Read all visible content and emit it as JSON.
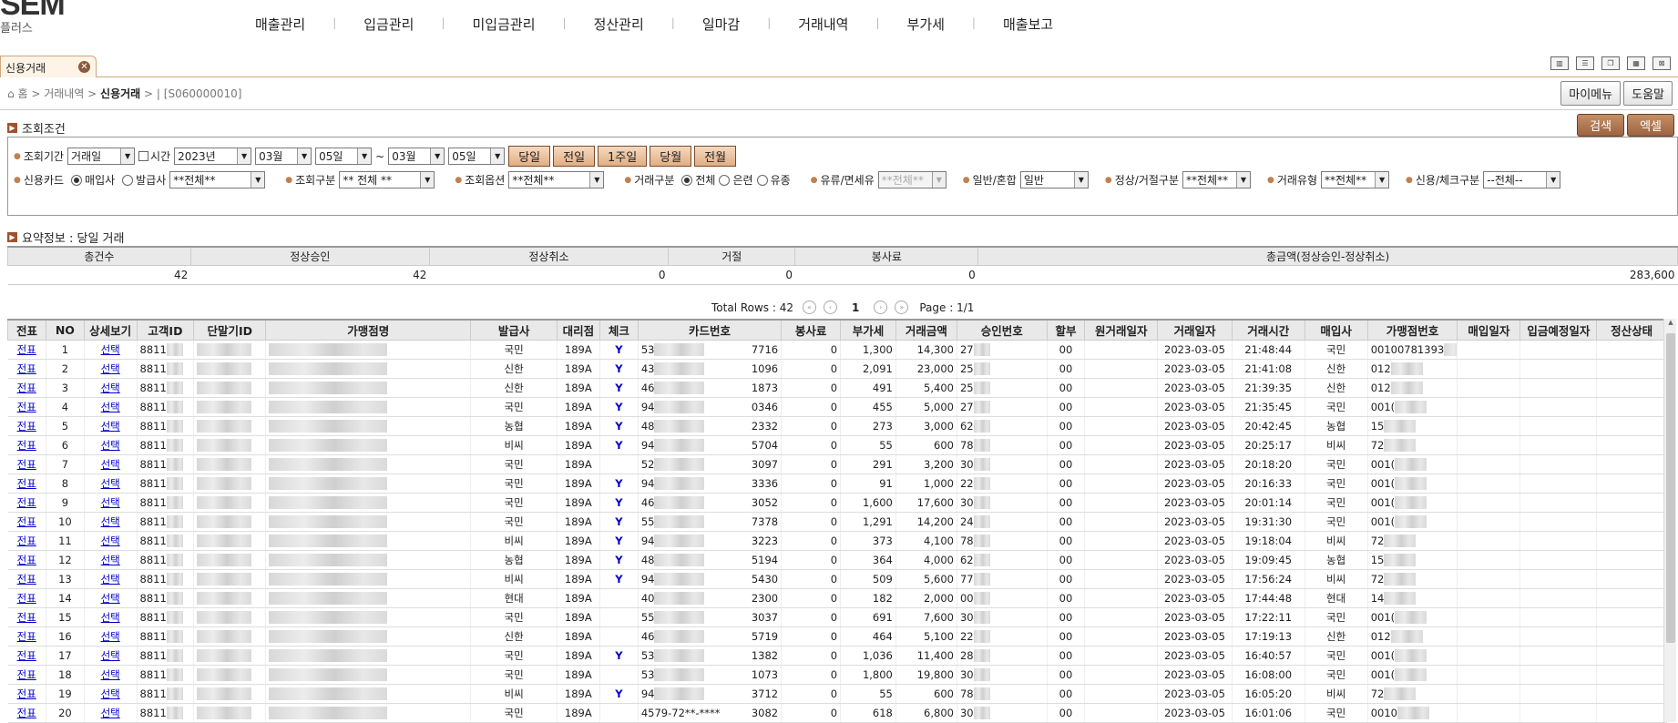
{
  "logo": {
    "big": "SEM",
    "sub": "플러스"
  },
  "nav": [
    "매출관리",
    "입금관리",
    "미입금관리",
    "정산관리",
    "일마감",
    "거래내역",
    "부가세",
    "매출보고"
  ],
  "tab": {
    "label": "신용거래"
  },
  "view_icons": [
    "layout-2col-icon",
    "layout-rows-icon",
    "layout-cascade-icon",
    "layout-grid-icon",
    "layout-close-icon"
  ],
  "breadcrumb": {
    "home": "홈",
    "level1": "거래내역",
    "current": "신용거래",
    "code": "| [S060000010]"
  },
  "top_buttons": {
    "mymenu": "마이메뉴",
    "help": "도움말"
  },
  "search": {
    "title": "조회조건",
    "search_btn": "검색",
    "excel_btn": "엑셀",
    "period_label": "조회기간",
    "period_type": "거래일",
    "time_label": "시간",
    "year": "2023년",
    "from_month": "03월",
    "from_day": "05일",
    "tilde": "~",
    "to_month": "03월",
    "to_day": "05일",
    "quick": [
      "당일",
      "전일",
      "1주일",
      "당월",
      "전월"
    ],
    "card_label": "신용카드",
    "card_opt1": "매입사",
    "card_opt2": "발급사",
    "card_value": "**전체**",
    "query_type_label": "조회구분",
    "query_type_value": "** 전체 **",
    "query_opt_label": "조회옵션",
    "query_opt_value": "**전체**",
    "tx_type_label": "거래구분",
    "tx_opt1": "전체",
    "tx_opt2": "은련",
    "tx_opt3": "유종",
    "tax_label": "유류/면세유",
    "tax_value": "**전체**",
    "general_label": "일반/혼합",
    "general_value": "일반",
    "normal_label": "정상/거절구분",
    "normal_value": "**전체**",
    "txkind_label": "거래유형",
    "txkind_value": "**전체**",
    "credit_label": "신용/체크구분",
    "credit_value": "--전체--"
  },
  "summary": {
    "title": "요약정보 : 당일 거래",
    "headers": [
      "총건수",
      "정상승인",
      "정상취소",
      "거절",
      "봉사료",
      "총금액(정상승인-정상취소)"
    ],
    "values": [
      "42",
      "42",
      "0",
      "0",
      "0",
      "283,600"
    ]
  },
  "pager": {
    "total_rows": "Total Rows : 42",
    "current": "1",
    "page_info": "Page : 1/1"
  },
  "grid": {
    "headers": [
      "전표",
      "NO",
      "상세보기",
      "고객ID",
      "단말기ID",
      "가맹점명",
      "발급사",
      "대리점",
      "체크",
      "카드번호",
      "봉사료",
      "부가세",
      "거래금액",
      "승인번호",
      "할부",
      "원거래일자",
      "거래일자",
      "거래시간",
      "매입사",
      "가맹점번호",
      "매입일자",
      "입금예정일자",
      "정산상태"
    ],
    "rows": [
      {
        "slip": "전표",
        "no": "1",
        "detail": "선택",
        "cust": "8811",
        "issuer": "국민",
        "agent": "189A",
        "check": "Y",
        "card_a": "53",
        "card_b": "7716",
        "svc": "0",
        "vat": "1,300",
        "amt": "14,300",
        "appr": "27",
        "inst": "00",
        "date": "2023-03-05",
        "time": "21:48:44",
        "acq": "국민",
        "merch": "00100781393"
      },
      {
        "slip": "전표",
        "no": "2",
        "detail": "선택",
        "cust": "8811",
        "issuer": "신한",
        "agent": "189A",
        "check": "Y",
        "card_a": "43",
        "card_b": "1096",
        "svc": "0",
        "vat": "2,091",
        "amt": "23,000",
        "appr": "25",
        "inst": "00",
        "date": "2023-03-05",
        "time": "21:41:08",
        "acq": "신한",
        "merch": "012"
      },
      {
        "slip": "전표",
        "no": "3",
        "detail": "선택",
        "cust": "8811",
        "issuer": "신한",
        "agent": "189A",
        "check": "Y",
        "card_a": "46",
        "card_b": "1873",
        "svc": "0",
        "vat": "491",
        "amt": "5,400",
        "appr": "25",
        "inst": "00",
        "date": "2023-03-05",
        "time": "21:39:35",
        "acq": "신한",
        "merch": "012"
      },
      {
        "slip": "전표",
        "no": "4",
        "detail": "선택",
        "cust": "8811",
        "issuer": "국민",
        "agent": "189A",
        "check": "Y",
        "card_a": "94",
        "card_b": "0346",
        "svc": "0",
        "vat": "455",
        "amt": "5,000",
        "appr": "27",
        "inst": "00",
        "date": "2023-03-05",
        "time": "21:35:45",
        "acq": "국민",
        "merch": "001("
      },
      {
        "slip": "전표",
        "no": "5",
        "detail": "선택",
        "cust": "8811",
        "issuer": "농협",
        "agent": "189A",
        "check": "Y",
        "card_a": "48",
        "card_b": "2332",
        "svc": "0",
        "vat": "273",
        "amt": "3,000",
        "appr": "62",
        "inst": "00",
        "date": "2023-03-05",
        "time": "20:42:45",
        "acq": "농협",
        "merch": "15"
      },
      {
        "slip": "전표",
        "no": "6",
        "detail": "선택",
        "cust": "8811",
        "issuer": "비씨",
        "agent": "189A",
        "check": "Y",
        "card_a": "94",
        "card_b": "5704",
        "svc": "0",
        "vat": "55",
        "amt": "600",
        "appr": "78",
        "inst": "00",
        "date": "2023-03-05",
        "time": "20:25:17",
        "acq": "비씨",
        "merch": "72"
      },
      {
        "slip": "전표",
        "no": "7",
        "detail": "선택",
        "cust": "8811",
        "issuer": "국민",
        "agent": "189A",
        "check": "",
        "card_a": "52",
        "card_b": "3097",
        "svc": "0",
        "vat": "291",
        "amt": "3,200",
        "appr": "30",
        "inst": "00",
        "date": "2023-03-05",
        "time": "20:18:20",
        "acq": "국민",
        "merch": "001("
      },
      {
        "slip": "전표",
        "no": "8",
        "detail": "선택",
        "cust": "8811",
        "issuer": "국민",
        "agent": "189A",
        "check": "Y",
        "card_a": "94",
        "card_b": "3336",
        "svc": "0",
        "vat": "91",
        "amt": "1,000",
        "appr": "22",
        "inst": "00",
        "date": "2023-03-05",
        "time": "20:16:33",
        "acq": "국민",
        "merch": "001("
      },
      {
        "slip": "전표",
        "no": "9",
        "detail": "선택",
        "cust": "8811",
        "issuer": "국민",
        "agent": "189A",
        "check": "Y",
        "card_a": "46",
        "card_b": "3052",
        "svc": "0",
        "vat": "1,600",
        "amt": "17,600",
        "appr": "30",
        "inst": "00",
        "date": "2023-03-05",
        "time": "20:01:14",
        "acq": "국민",
        "merch": "001("
      },
      {
        "slip": "전표",
        "no": "10",
        "detail": "선택",
        "cust": "8811",
        "issuer": "국민",
        "agent": "189A",
        "check": "Y",
        "card_a": "55",
        "card_b": "7378",
        "svc": "0",
        "vat": "1,291",
        "amt": "14,200",
        "appr": "24",
        "inst": "00",
        "date": "2023-03-05",
        "time": "19:31:30",
        "acq": "국민",
        "merch": "001("
      },
      {
        "slip": "전표",
        "no": "11",
        "detail": "선택",
        "cust": "8811",
        "issuer": "비씨",
        "agent": "189A",
        "check": "Y",
        "card_a": "94",
        "card_b": "3223",
        "svc": "0",
        "vat": "373",
        "amt": "4,100",
        "appr": "78",
        "inst": "00",
        "date": "2023-03-05",
        "time": "19:18:04",
        "acq": "비씨",
        "merch": "72"
      },
      {
        "slip": "전표",
        "no": "12",
        "detail": "선택",
        "cust": "8811",
        "issuer": "농협",
        "agent": "189A",
        "check": "Y",
        "card_a": "48",
        "card_b": "5194",
        "svc": "0",
        "vat": "364",
        "amt": "4,000",
        "appr": "62",
        "inst": "00",
        "date": "2023-03-05",
        "time": "19:09:45",
        "acq": "농협",
        "merch": "15"
      },
      {
        "slip": "전표",
        "no": "13",
        "detail": "선택",
        "cust": "8811",
        "issuer": "비씨",
        "agent": "189A",
        "check": "Y",
        "card_a": "94",
        "card_b": "5430",
        "svc": "0",
        "vat": "509",
        "amt": "5,600",
        "appr": "77",
        "inst": "00",
        "date": "2023-03-05",
        "time": "17:56:24",
        "acq": "비씨",
        "merch": "72"
      },
      {
        "slip": "전표",
        "no": "14",
        "detail": "선택",
        "cust": "8811",
        "issuer": "현대",
        "agent": "189A",
        "check": "",
        "card_a": "40",
        "card_b": "2300",
        "svc": "0",
        "vat": "182",
        "amt": "2,000",
        "appr": "00",
        "inst": "00",
        "date": "2023-03-05",
        "time": "17:44:48",
        "acq": "현대",
        "merch": "14"
      },
      {
        "slip": "전표",
        "no": "15",
        "detail": "선택",
        "cust": "8811",
        "issuer": "국민",
        "agent": "189A",
        "check": "",
        "card_a": "55",
        "card_b": "3037",
        "svc": "0",
        "vat": "691",
        "amt": "7,600",
        "appr": "30",
        "inst": "00",
        "date": "2023-03-05",
        "time": "17:22:11",
        "acq": "국민",
        "merch": "001("
      },
      {
        "slip": "전표",
        "no": "16",
        "detail": "선택",
        "cust": "8811",
        "issuer": "신한",
        "agent": "189A",
        "check": "",
        "card_a": "46",
        "card_b": "5719",
        "svc": "0",
        "vat": "464",
        "amt": "5,100",
        "appr": "22",
        "inst": "00",
        "date": "2023-03-05",
        "time": "17:19:13",
        "acq": "신한",
        "merch": "012"
      },
      {
        "slip": "전표",
        "no": "17",
        "detail": "선택",
        "cust": "8811",
        "issuer": "국민",
        "agent": "189A",
        "check": "Y",
        "card_a": "53",
        "card_b": "1382",
        "svc": "0",
        "vat": "1,036",
        "amt": "11,400",
        "appr": "28",
        "inst": "00",
        "date": "2023-03-05",
        "time": "16:40:57",
        "acq": "국민",
        "merch": "001("
      },
      {
        "slip": "전표",
        "no": "18",
        "detail": "선택",
        "cust": "8811",
        "issuer": "국민",
        "agent": "189A",
        "check": "",
        "card_a": "53",
        "card_b": "1073",
        "svc": "0",
        "vat": "1,800",
        "amt": "19,800",
        "appr": "30",
        "inst": "00",
        "date": "2023-03-05",
        "time": "16:08:00",
        "acq": "국민",
        "merch": "001("
      },
      {
        "slip": "전표",
        "no": "19",
        "detail": "선택",
        "cust": "8811",
        "issuer": "비씨",
        "agent": "189A",
        "check": "Y",
        "card_a": "94",
        "card_b": "3712",
        "svc": "0",
        "vat": "55",
        "amt": "600",
        "appr": "78",
        "inst": "00",
        "date": "2023-03-05",
        "time": "16:05:20",
        "acq": "비씨",
        "merch": "72"
      },
      {
        "slip": "전표",
        "no": "20",
        "detail": "선택",
        "cust": "8811",
        "issuer": "국민",
        "agent": "189A",
        "check": "",
        "card_a": "4579-72**-****",
        "card_b": "3082",
        "svc": "0",
        "vat": "618",
        "amt": "6,800",
        "appr": "30",
        "inst": "00",
        "date": "2023-03-05",
        "time": "16:01:06",
        "acq": "국민",
        "merch": "0010"
      }
    ]
  }
}
